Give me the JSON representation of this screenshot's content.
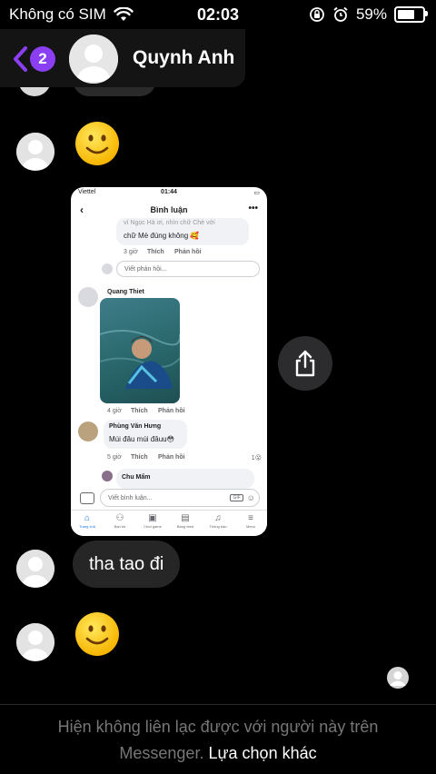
{
  "status_bar": {
    "carrier": "Không có SIM",
    "time": "02:03",
    "battery_percent": "59%",
    "battery_level": 0.59
  },
  "header": {
    "unread_badge": "2",
    "contact_name": "Quynh Anh"
  },
  "screenshot": {
    "carrier": "Viettel",
    "time": "01:44",
    "title": "Bình luận",
    "top_comment_line1": "ví Ngọc Hà ơi, nhìn chữ Chè với",
    "top_comment_line2": "chữ Mè đúng không 🥰",
    "top_meta": [
      "3 giờ",
      "Thích",
      "Phản hồi"
    ],
    "reply_placeholder": "Viết phản hồi...",
    "comment1_author": "Quang Thiet",
    "comment1_meta": [
      "4 giờ",
      "Thích",
      "Phản hồi"
    ],
    "comment2_author": "Phùng Văn Hưng",
    "comment2_text": "Múi đâu múi đâuu😳",
    "comment2_meta": [
      "5 giờ",
      "Thích",
      "Phản hồi"
    ],
    "comment2_reactions": "1😮",
    "comment3_author": "Chu Mẩm",
    "comment_placeholder": "Viết bình luận...",
    "tabs": [
      {
        "label": "Trang chủ",
        "icon": "home-icon"
      },
      {
        "label": "Bạn bè",
        "icon": "friends-icon"
      },
      {
        "label": "Chơi game",
        "icon": "gaming-icon"
      },
      {
        "label": "Bảng feed",
        "icon": "feed-icon"
      },
      {
        "label": "Thông báo",
        "icon": "bell-icon"
      },
      {
        "label": "Menu",
        "icon": "menu-icon"
      }
    ]
  },
  "messages": {
    "text_bubble": "tha tao đi"
  },
  "footer": {
    "notice": "Hiện không liên lạc được với người này trên Messenger.",
    "link": "Lựa chọn khác"
  },
  "colors": {
    "accent": "#8b3ff2",
    "bubble": "#262626",
    "background": "#000000"
  }
}
